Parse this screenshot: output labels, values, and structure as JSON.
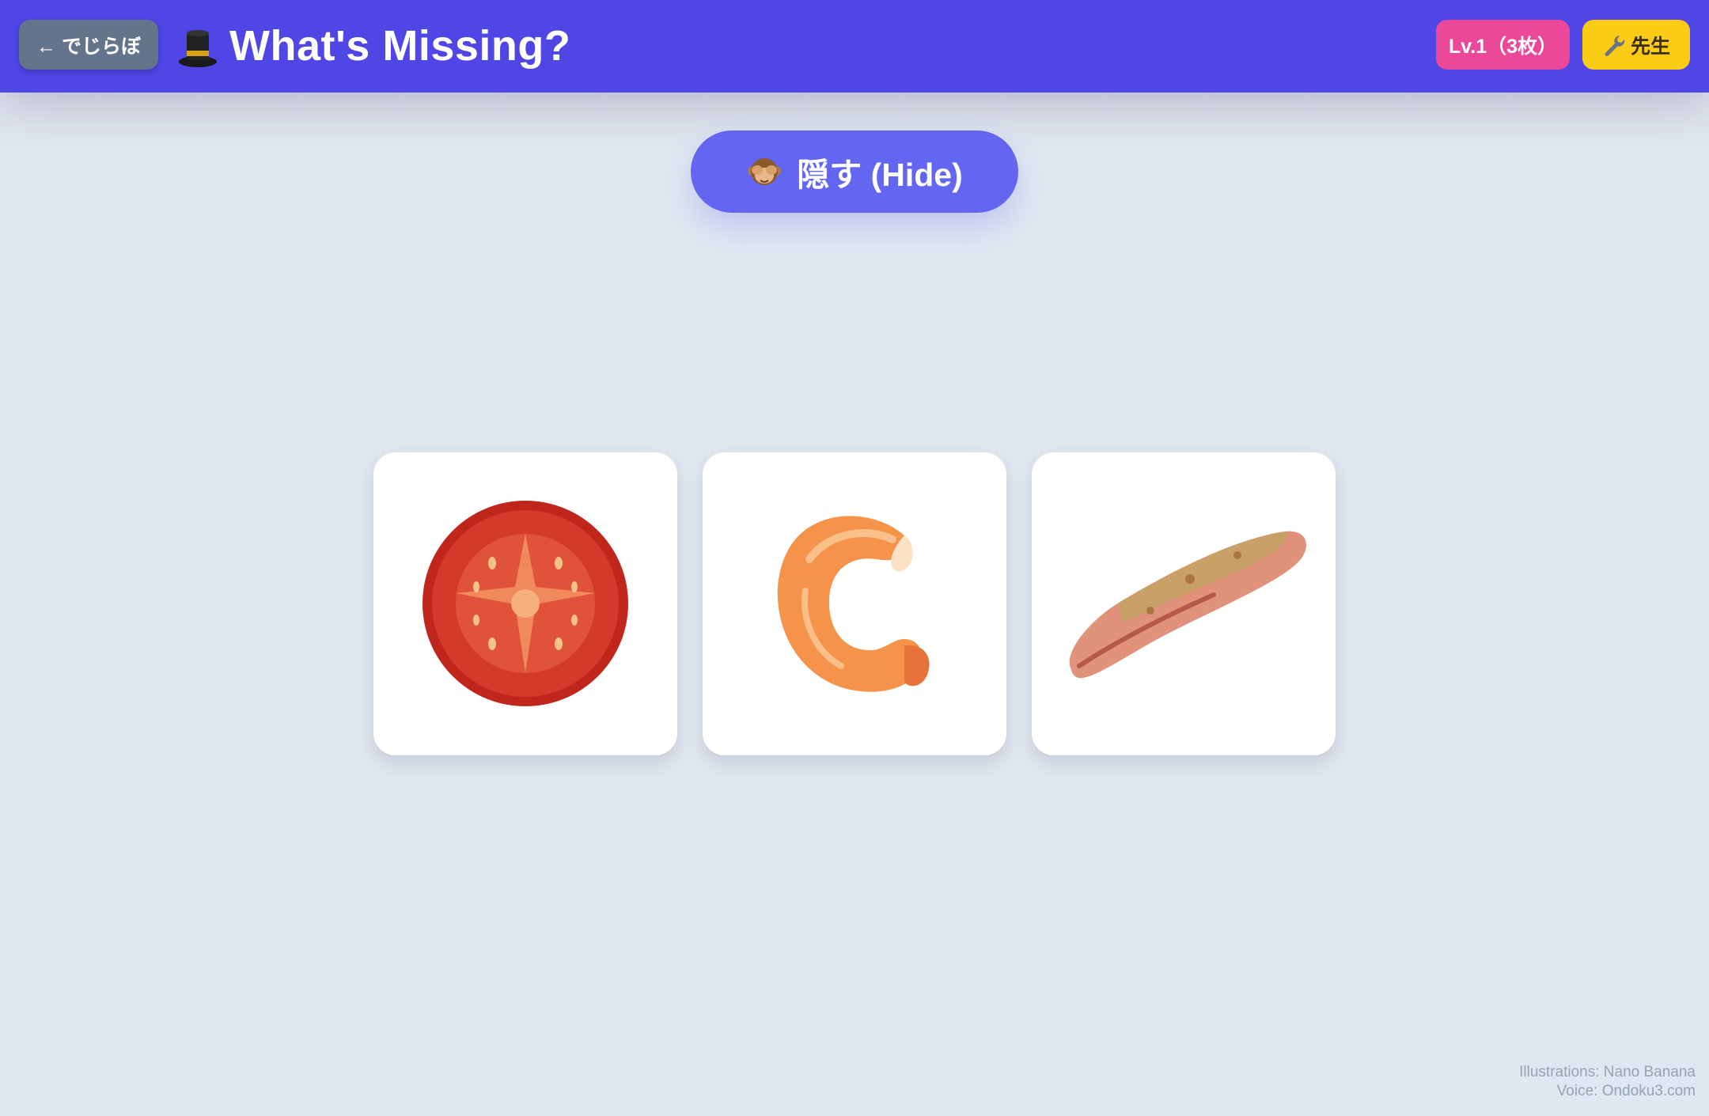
{
  "header": {
    "back_label": "← でじらぼ",
    "title": "What's Missing?",
    "title_icon": "top-hat-icon",
    "level_label": "Lv.1（3枚）",
    "teacher_label": "先生",
    "teacher_icon": "wrench-icon",
    "colors": {
      "bar": "#4f46e5",
      "back": "#64748b",
      "level": "#ec4899",
      "teacher": "#facc15"
    }
  },
  "actions": {
    "hide_label": "隠す (Hide)",
    "hide_icon": "see-no-evil-monkey-icon",
    "hide_color": "#6366f1"
  },
  "cards": [
    {
      "item": "tomato-slice"
    },
    {
      "item": "shrimp"
    },
    {
      "item": "grilled-sausage"
    }
  ],
  "credits": {
    "illustrations": "Illustrations: Nano Banana",
    "voice": "Voice: Ondoku3.com"
  }
}
